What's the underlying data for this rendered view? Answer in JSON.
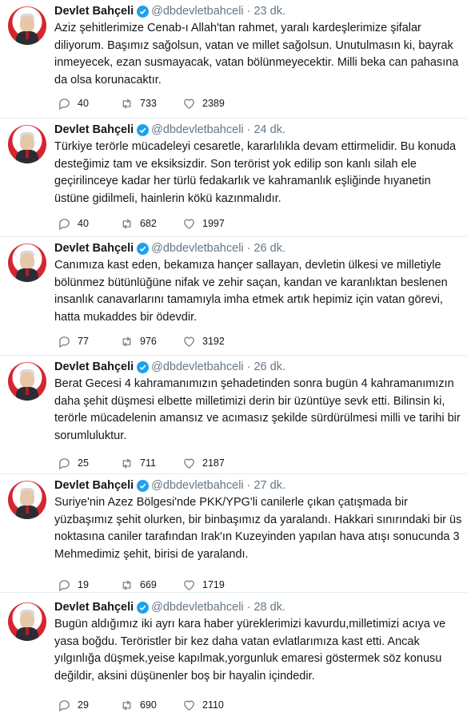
{
  "tweets": [
    {
      "name": "Devlet Bahçeli",
      "handle": "@dbdevletbahceli",
      "time": "23 dk.",
      "text": "Aziz şehitlerimize Cenab-ı Allah'tan rahmet, yaralı kardeşlerimize şifalar diliyorum. Başımız sağolsun, vatan ve millet sağolsun. Unutulmasın ki, bayrak inmeyecek, ezan susmayacak, vatan bölünmeyecektir. Milli beka can pahasına da olsa korunacaktır.",
      "replies": "40",
      "retweets": "733",
      "likes": "2389"
    },
    {
      "name": "Devlet Bahçeli",
      "handle": "@dbdevletbahceli",
      "time": "24 dk.",
      "text": "Türkiye terörle mücadeleyi cesaretle, kararlılıkla devam ettirmelidir. Bu konuda desteğimiz tam ve eksiksizdir. Son terörist yok edilip son kanlı silah ele geçirilinceye kadar her türlü fedakarlık ve kahramanlık eşliğinde hıyanetin üstüne gidilmeli, hainlerin kökü kazınmalıdır.",
      "replies": "40",
      "retweets": "682",
      "likes": "1997"
    },
    {
      "name": "Devlet Bahçeli",
      "handle": "@dbdevletbahceli",
      "time": "26 dk.",
      "text": "Canımıza kast eden, bekamıza hançer sallayan, devletin ülkesi ve milletiyle bölünmez bütünlüğüne nifak ve zehir saçan, kandan ve karanlıktan beslenen insanlık canavarlarını tamamıyla imha etmek artık hepimiz için vatan görevi, hatta mukaddes bir ödevdir.",
      "replies": "77",
      "retweets": "976",
      "likes": "3192"
    },
    {
      "name": "Devlet Bahçeli",
      "handle": "@dbdevletbahceli",
      "time": "26 dk.",
      "text": "Berat Gecesi 4 kahramanımızın şehadetinden sonra bugün 4 kahramanımızın daha şehit düşmesi elbette milletimizi derin bir üzüntüye sevk etti. Bilinsin ki, terörle mücadelenin amansız ve acımasız şekilde sürdürülmesi milli ve tarihi bir sorumluluktur.",
      "replies": "25",
      "retweets": "711",
      "likes": "2187"
    },
    {
      "name": "Devlet Bahçeli",
      "handle": "@dbdevletbahceli",
      "time": "27 dk.",
      "text": "Suriye'nin Azez Bölgesi'nde PKK/YPG'li canilerle çıkan çatışmada bir yüzbaşımız şehit olurken, bir binbaşımız da yaralandı. Hakkari sınırındaki bir üs noktasına caniler tarafından Irak'ın Kuzeyinden yapılan hava atışı sonucunda 3 Mehmedimiz şehit, birisi de yaralandı.",
      "replies": "19",
      "retweets": "669",
      "likes": "1719"
    },
    {
      "name": "Devlet Bahçeli",
      "handle": "@dbdevletbahceli",
      "time": "28 dk.",
      "text": "Bugün aldığımız iki ayrı kara haber yüreklerimizi kavurdu,milletimizi acıya ve yasa boğdu. Teröristler bir kez daha vatan evlatlarımıza kast etti. Ancak yılgınlığa düşmek,yeise kapılmak,yorgunluk emaresi göstermek söz konusu değildir, aksini düşünenler boş bir hayalin içindedir.",
      "replies": "29",
      "retweets": "690",
      "likes": "2110"
    }
  ],
  "icons": {
    "reply": "reply-icon",
    "retweet": "retweet-icon",
    "like": "heart-icon",
    "verified": "verified-badge-icon"
  },
  "colors": {
    "verified": "#1da1f2",
    "muted": "#657786",
    "divider": "#e6ecf0"
  }
}
